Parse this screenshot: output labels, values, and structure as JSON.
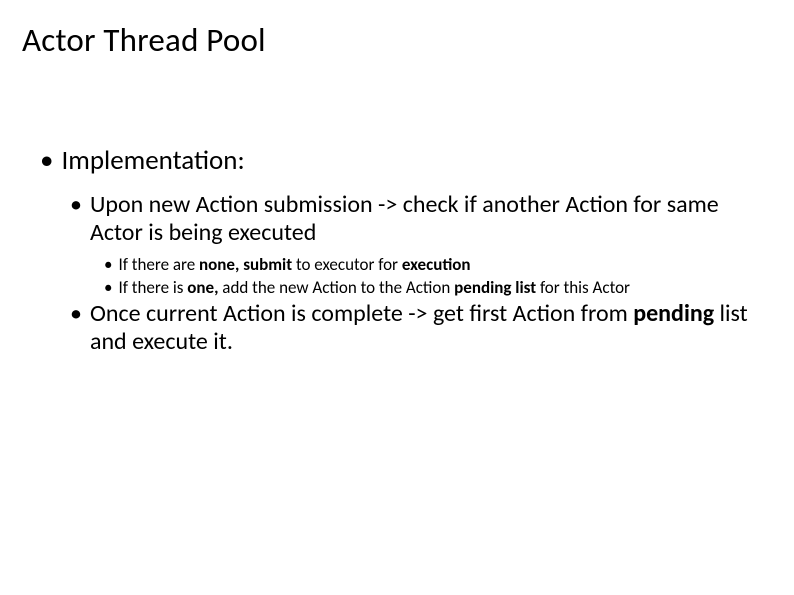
{
  "title": "Actor Thread Pool",
  "l1": {
    "bullet": "•",
    "text": "Implementation:"
  },
  "l2a": {
    "bullet": "•",
    "text": "Upon new Action submission -> check if another Action for same Actor is being executed"
  },
  "l3a": {
    "bullet": "•",
    "p1": "If there are ",
    "b1": "none, submit",
    "p2": " to executor for ",
    "b2": "execution"
  },
  "l3b": {
    "bullet": "•",
    "p1": "If there is ",
    "b1": "one,",
    "p2": " add the new Action to the Action ",
    "b2": "pending list",
    "p3": " for this Actor"
  },
  "l2b": {
    "bullet": "•",
    "p1": "Once current Action is complete -> get first Action from ",
    "b1": "pending",
    "p2": " list and execute it."
  }
}
